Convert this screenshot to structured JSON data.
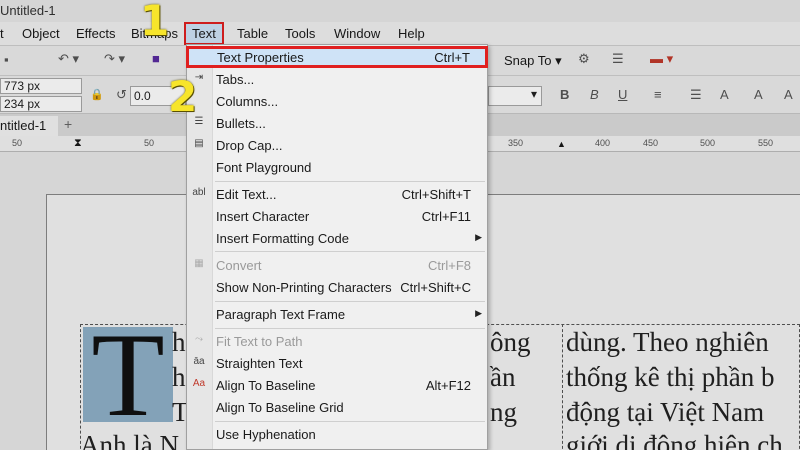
{
  "window": {
    "title": "Untitled-1"
  },
  "menubar": {
    "items": [
      "t",
      "Object",
      "Effects",
      "Bitmaps",
      "Text",
      "Table",
      "Tools",
      "Window",
      "Help"
    ]
  },
  "toolbar": {
    "snap_to": "Snap To",
    "width": "773 px",
    "height": "234 px",
    "rotation": "0.0"
  },
  "document_tab": {
    "label": "ntitled-1",
    "add": "+"
  },
  "ruler": {
    "ticks": [
      "50",
      "50",
      "350",
      "400",
      "450",
      "500",
      "550"
    ]
  },
  "text_menu": {
    "items": [
      {
        "label": "Text Properties",
        "shortcut": "Ctrl+T",
        "highlighted": true
      },
      {
        "label": "Tabs..."
      },
      {
        "label": "Columns..."
      },
      {
        "label": "Bullets..."
      },
      {
        "label": "Drop Cap..."
      },
      {
        "label": "Font Playground"
      },
      {
        "label": "Edit Text...",
        "shortcut": "Ctrl+Shift+T"
      },
      {
        "label": "Insert Character",
        "shortcut": "Ctrl+F11"
      },
      {
        "label": "Insert Formatting Code",
        "submenu": true
      },
      {
        "label": "Convert",
        "shortcut": "Ctrl+F8",
        "disabled": true
      },
      {
        "label": "Show Non-Printing Characters",
        "shortcut": "Ctrl+Shift+C"
      },
      {
        "label": "Paragraph Text Frame",
        "submenu": true
      },
      {
        "label": "Fit Text to Path",
        "disabled": true
      },
      {
        "label": "Straighten Text"
      },
      {
        "label": "Align To Baseline",
        "shortcut": "Alt+F12"
      },
      {
        "label": "Align To Baseline Grid"
      },
      {
        "label": "Use Hyphenation"
      }
    ]
  },
  "document_text": {
    "drop_cap": "T",
    "left_lines": [
      "h",
      "h",
      "T",
      "Anh là N"
    ],
    "left_tails": [
      "ông",
      "ần",
      "ng"
    ],
    "right_lines": [
      "dùng. Theo nghiên",
      "thống kê thị phần b",
      "động tại Việt Nam",
      "giới di động hiện ch"
    ]
  },
  "annotations": {
    "step1": "1",
    "step2": "2"
  },
  "colors": {
    "highlight_border": "#e02020",
    "step_marker": "#f7e52b",
    "drop_cap_bg": "#8fb0c8"
  }
}
